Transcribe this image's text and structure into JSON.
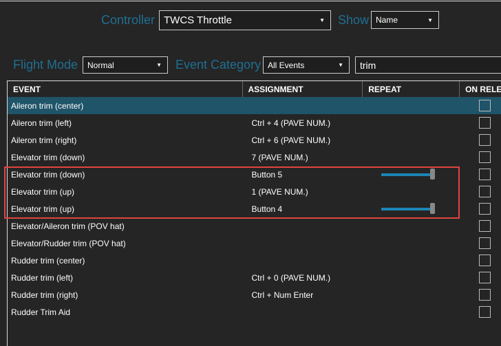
{
  "controller": {
    "label": "Controller",
    "value": "TWCS Throttle"
  },
  "show": {
    "label": "Show",
    "value": "Name"
  },
  "flight_mode": {
    "label": "Flight Mode",
    "value": "Normal"
  },
  "event_category": {
    "label": "Event Category",
    "value": "All Events"
  },
  "search": {
    "value": "trim"
  },
  "table": {
    "headers": [
      "EVENT",
      "ASSIGNMENT",
      "REPEAT",
      "ON RELEASE"
    ],
    "rows": [
      {
        "event": "Aileron trim (center)",
        "assignment": "",
        "repeat": null,
        "selected": true
      },
      {
        "event": "Aileron trim (left)",
        "assignment": "Ctrl + 4 (PAVE NUM.)",
        "repeat": null
      },
      {
        "event": "Aileron trim (right)",
        "assignment": "Ctrl + 6 (PAVE NUM.)",
        "repeat": null
      },
      {
        "event": "Elevator trim (down)",
        "assignment": "7 (PAVE NUM.)",
        "repeat": null
      },
      {
        "event": "Elevator trim (down)",
        "assignment": "Button 5",
        "repeat": 1.0
      },
      {
        "event": "Elevator trim (up)",
        "assignment": "1 (PAVE NUM.)",
        "repeat": null
      },
      {
        "event": "Elevator trim (up)",
        "assignment": "Button 4",
        "repeat": 1.0
      },
      {
        "event": "Elevator/Aileron trim (POV hat)",
        "assignment": "",
        "repeat": null
      },
      {
        "event": "Elevator/Rudder trim (POV hat)",
        "assignment": "",
        "repeat": null
      },
      {
        "event": "Rudder trim (center)",
        "assignment": "",
        "repeat": null
      },
      {
        "event": "Rudder trim (left)",
        "assignment": "Ctrl + 0 (PAVE NUM.)",
        "repeat": null
      },
      {
        "event": "Rudder trim (right)",
        "assignment": "Ctrl + Num Enter",
        "repeat": null
      },
      {
        "event": "Rudder Trim Aid",
        "assignment": "",
        "repeat": null
      }
    ]
  },
  "colors": {
    "accent": "#1f6f92",
    "selected_row": "#1f5469",
    "highlight_box": "#e0443e",
    "slider": "#1b86b5"
  }
}
